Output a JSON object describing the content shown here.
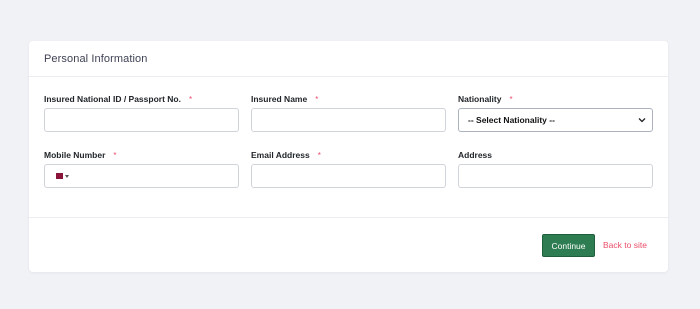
{
  "card": {
    "title": "Personal Information"
  },
  "fields": {
    "national_id": {
      "label": "Insured National ID / Passport No.",
      "required_mark": "*",
      "value": ""
    },
    "insured_name": {
      "label": "Insured Name",
      "required_mark": "*",
      "value": ""
    },
    "nationality": {
      "label": "Nationality",
      "required_mark": "*",
      "selected": "-- Select Nationality --"
    },
    "mobile": {
      "label": "Mobile Number",
      "required_mark": "*",
      "value": "",
      "flag_icon": "qatar-flag-icon"
    },
    "email": {
      "label": "Email Address",
      "required_mark": "*",
      "value": ""
    },
    "address": {
      "label": "Address",
      "value": ""
    }
  },
  "actions": {
    "continue_label": "Continue",
    "back_label": "Back to site"
  },
  "colors": {
    "primary_button": "#2e7d52",
    "link": "#e94d6a",
    "required": "#e94d6a",
    "background": "#f1f2f6"
  }
}
